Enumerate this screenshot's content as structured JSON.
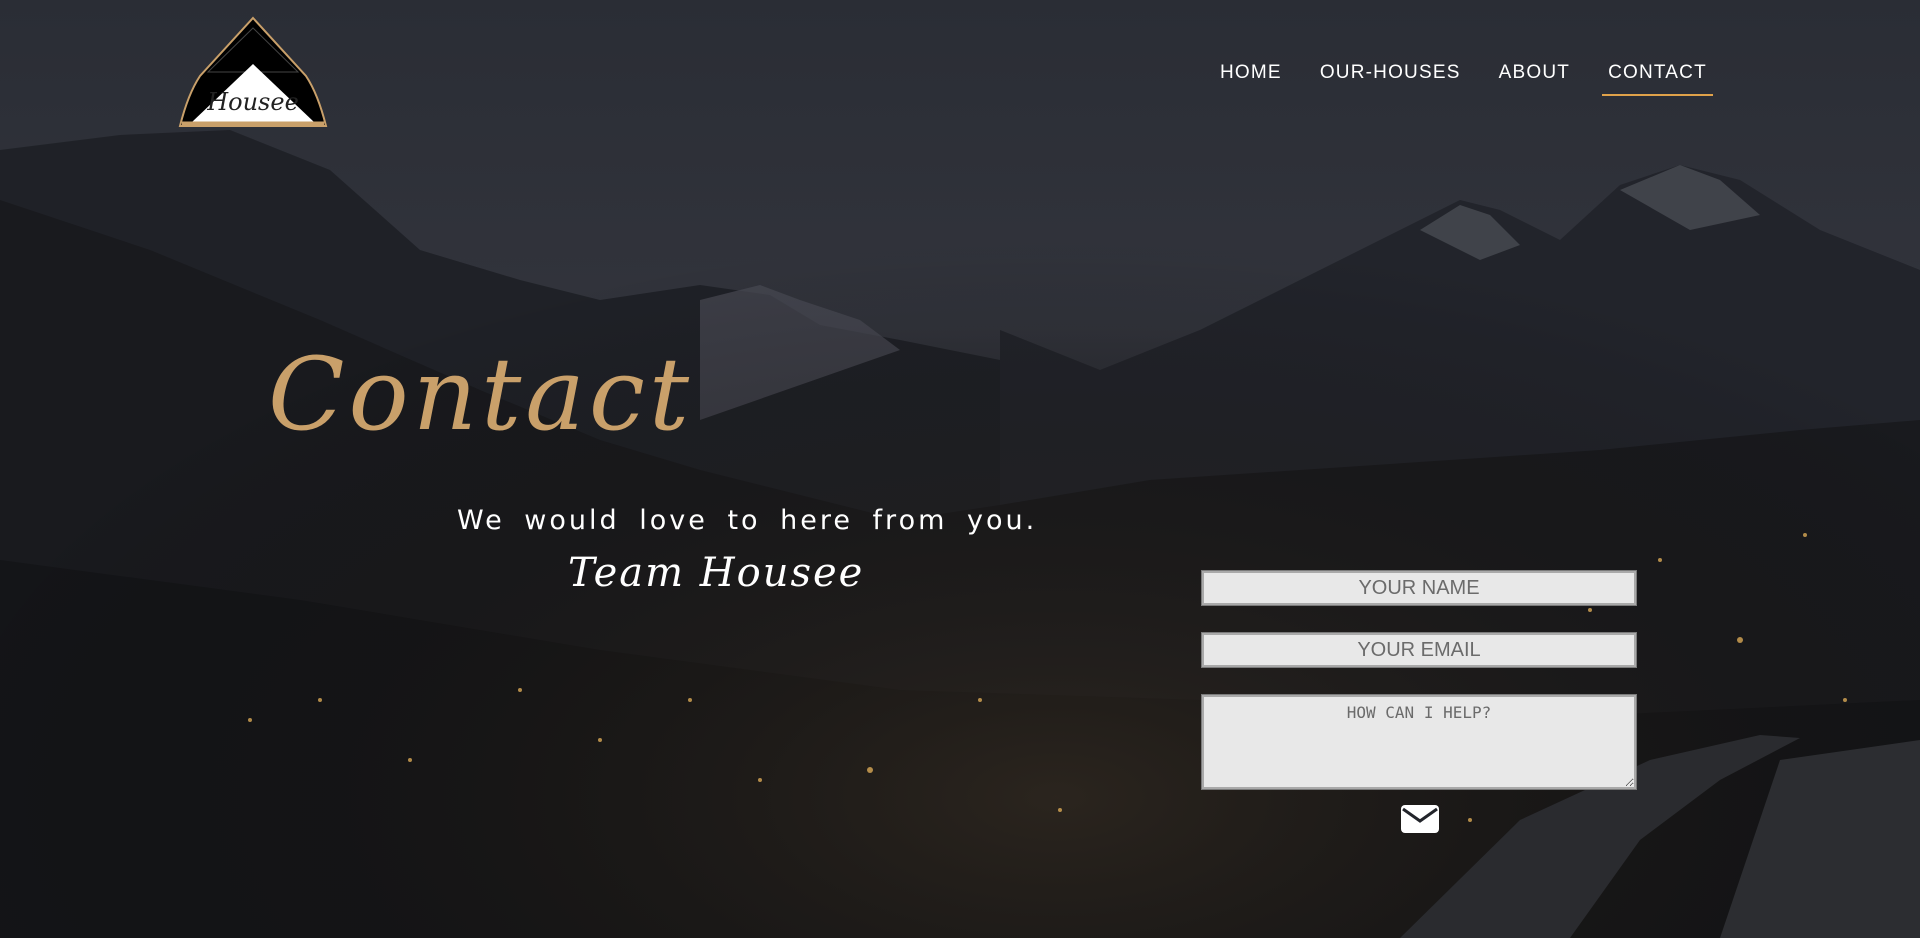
{
  "brand": {
    "name": "Housee"
  },
  "nav": {
    "items": [
      {
        "label": "HOME"
      },
      {
        "label": "OUR-HOUSES"
      },
      {
        "label": "ABOUT"
      },
      {
        "label": "CONTACT",
        "active": true
      }
    ],
    "active_underline_color": "#e0a24a"
  },
  "hero": {
    "title": "Contact",
    "subtitle": "We would love to here from you.",
    "signature": "Team Housee",
    "title_color": "#c9a06a"
  },
  "form": {
    "name_placeholder": "YOUR NAME",
    "email_placeholder": "YOUR EMAIL",
    "message_placeholder": "HOW CAN I HELP?",
    "send_icon": "envelope-icon"
  }
}
